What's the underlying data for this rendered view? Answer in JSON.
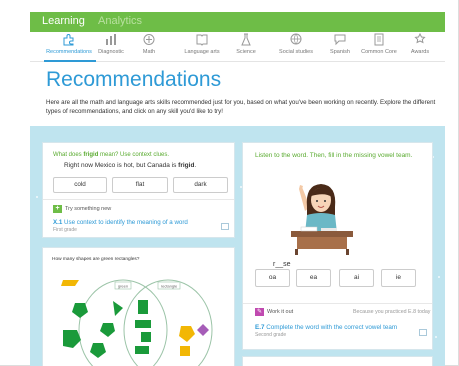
{
  "header": {
    "tabs": [
      {
        "label": "Learning",
        "active": true
      },
      {
        "label": "Analytics",
        "active": false
      }
    ],
    "accent_color": "#6ebd47"
  },
  "nav": {
    "items": [
      {
        "label": "Recommendations",
        "icon": "puzzle-icon",
        "active": true
      },
      {
        "label": "Diagnostic",
        "icon": "bar-chart-icon"
      },
      {
        "label": "Math",
        "icon": "calculator-icon"
      },
      {
        "label": "Language arts",
        "icon": "book-icon"
      },
      {
        "label": "Science",
        "icon": "flask-icon"
      },
      {
        "label": "Social studies",
        "icon": "globe-icon"
      },
      {
        "label": "Spanish",
        "icon": "speech-bubble-icon"
      },
      {
        "label": "Common Core",
        "icon": "document-icon"
      },
      {
        "label": "Awards",
        "icon": "award-icon"
      }
    ],
    "active_color": "#2e9ad6"
  },
  "page": {
    "title": "Recommendations",
    "intro": "Here are all the math and language arts skills recommended just for you, based on what you've been working on recently. Explore the different types of recommendations, and click on any skill you'd like to try!"
  },
  "card1": {
    "question_prefix": "What does ",
    "question_word": "frigid",
    "question_suffix": " mean? Use context clues.",
    "sentence_prefix": "Right now Mexico is hot, but Canada is ",
    "sentence_word": "frigid",
    "sentence_suffix": ".",
    "choices": [
      "cold",
      "flat",
      "dark"
    ],
    "badge_text": "Try something new",
    "skill_code": "X.1",
    "skill_name": "Use context to identify the meaning of a word",
    "grade": "First grade"
  },
  "card2": {
    "question": "How many shapes are green rectangles?",
    "venn_labels": [
      "green",
      "rectangle"
    ]
  },
  "card3": {
    "instruction": "Listen to the word. Then, fill in the missing vowel team.",
    "word": "r__se",
    "choices": [
      "oa",
      "ea",
      "ai",
      "ie"
    ],
    "badge_text": "Work it out",
    "reason": "Because you practiced E.8 today",
    "skill_code": "E.7",
    "skill_name": "Complete the word with the correct vowel team",
    "grade": "Second grade"
  }
}
